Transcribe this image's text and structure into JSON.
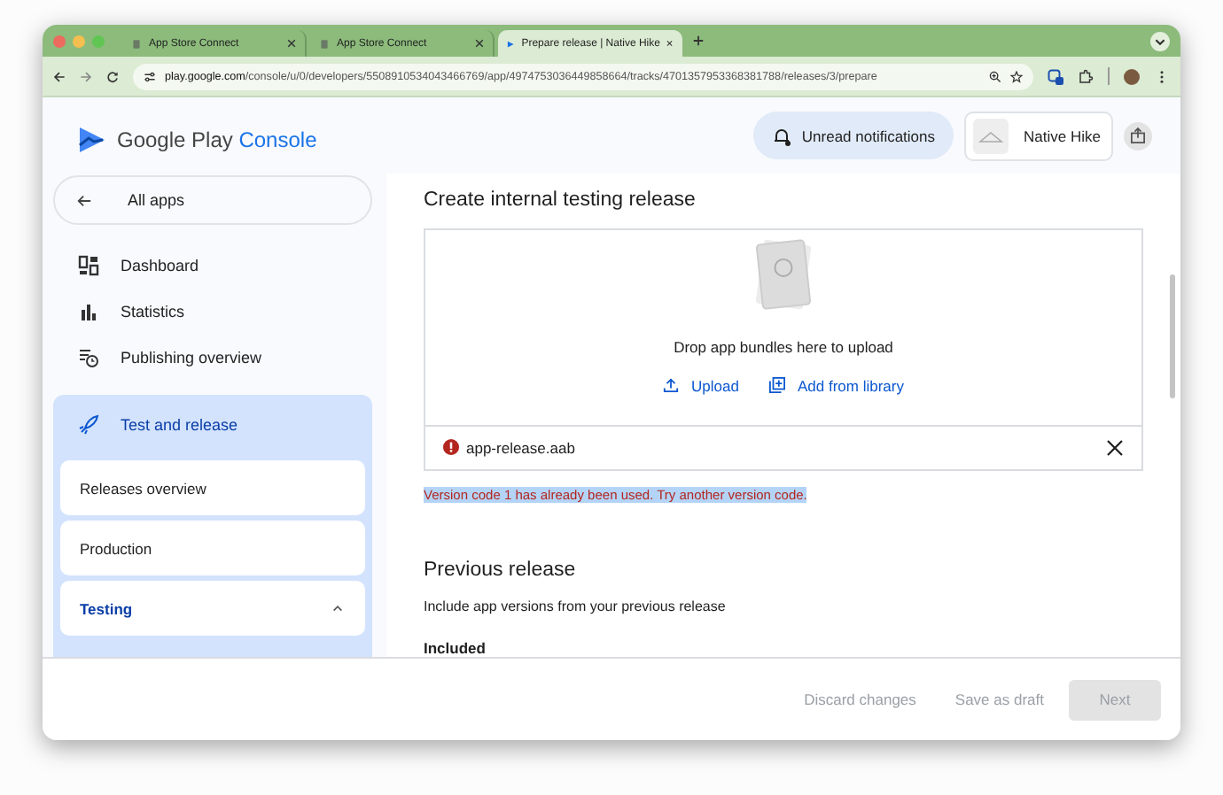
{
  "browser": {
    "tabs": [
      {
        "title": "App Store Connect",
        "selected": false
      },
      {
        "title": "App Store Connect",
        "selected": false
      },
      {
        "title": "Prepare release | Native Hike",
        "selected": true
      }
    ],
    "url_domain": "play.google.com",
    "url_path": "/console/u/0/developers/5508910534043466769/app/4974753036449858664/tracks/4701357953368381788/releases/3/prepare"
  },
  "sidebar": {
    "logo_brand": "Google Play",
    "logo_product": "Console",
    "back_label": "All apps",
    "items": [
      {
        "label": "Dashboard",
        "kind": "dashboard"
      },
      {
        "label": "Statistics",
        "kind": "statistics"
      },
      {
        "label": "Publishing overview",
        "kind": "publishing"
      }
    ],
    "section": {
      "label": "Test and release",
      "expanded": true,
      "children": [
        {
          "label": "Releases overview",
          "selected": false,
          "expandable": false
        },
        {
          "label": "Production",
          "selected": false,
          "expandable": false
        },
        {
          "label": "Testing",
          "selected": true,
          "expandable": true,
          "expanded": true
        }
      ]
    }
  },
  "header": {
    "notifications": "Unread notifications",
    "app_name": "Native Hike"
  },
  "release": {
    "title": "Create internal testing release",
    "drop_hint": "Drop app bundles here to upload",
    "actions": [
      {
        "label": "Upload",
        "kind": "upload"
      },
      {
        "label": "Add from library",
        "kind": "library"
      }
    ],
    "file": {
      "name": "app-release.aab",
      "error": true
    },
    "error_message": "Version code 1 has already been used. Try another version code.",
    "error_highlighted": true
  },
  "previous": {
    "title": "Previous release",
    "description": "Include app versions from your previous release",
    "included_label": "Included"
  },
  "footer": {
    "buttons": [
      {
        "label": "Discard changes",
        "kind": "text",
        "disabled": true
      },
      {
        "label": "Save as draft",
        "kind": "text",
        "disabled": true
      },
      {
        "label": "Next",
        "kind": "filled",
        "disabled": true
      }
    ]
  }
}
